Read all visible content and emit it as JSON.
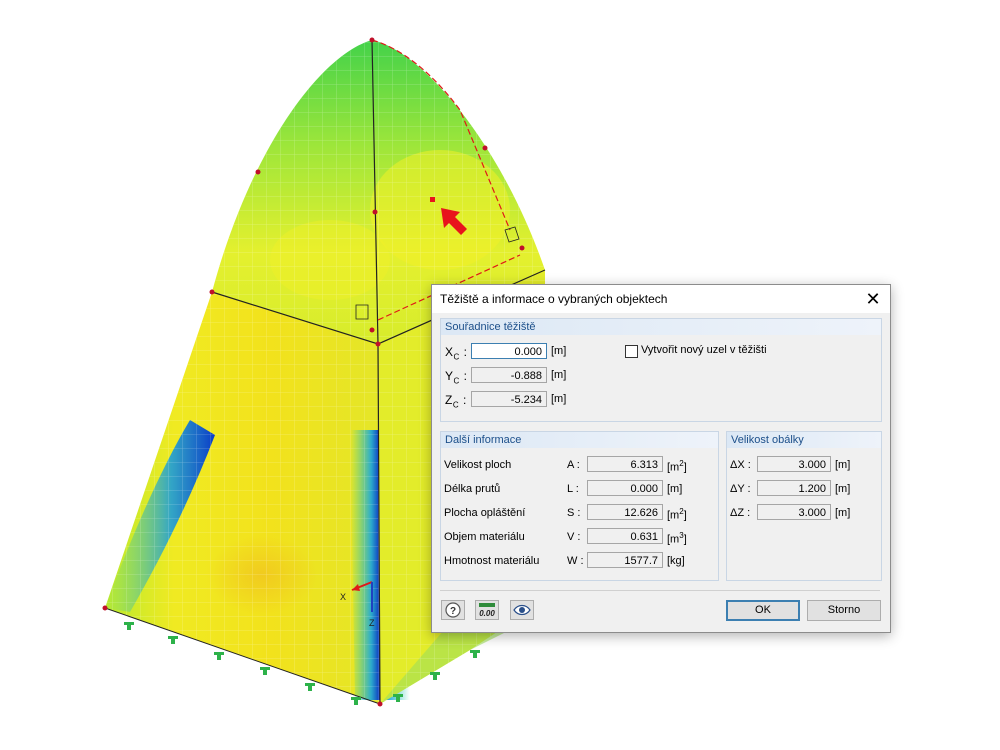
{
  "dialog": {
    "title": "Těžiště a informace o vybraných objektech",
    "close_glyph": "✕",
    "centroid": {
      "heading": "Souřadnice těžiště",
      "rows": [
        {
          "axis": "X",
          "sub": "C",
          "value": "0.000",
          "unit": "[m]"
        },
        {
          "axis": "Y",
          "sub": "C",
          "value": "-0.888",
          "unit": "[m]"
        },
        {
          "axis": "Z",
          "sub": "C",
          "value": "-5.234",
          "unit": "[m]"
        }
      ],
      "create_node_label": "Vytvořit nový uzel v těžišti"
    },
    "info": {
      "heading": "Další informace",
      "rows": [
        {
          "label": "Velikost ploch",
          "symbol": "A :",
          "value": "6.313",
          "unit": "[m",
          "sup": "2",
          "close": "]"
        },
        {
          "label": "Délka prutů",
          "symbol": "L :",
          "value": "0.000",
          "unit": "[m]",
          "sup": "",
          "close": ""
        },
        {
          "label": "Plocha opláštění",
          "symbol": "S :",
          "value": "12.626",
          "unit": "[m",
          "sup": "2",
          "close": "]"
        },
        {
          "label": "Objem materiálu",
          "symbol": "V :",
          "value": "0.631",
          "unit": "[m",
          "sup": "3",
          "close": "]"
        },
        {
          "label": "Hmotnost materiálu",
          "symbol": "W :",
          "value": "1577.7",
          "unit": "[kg]",
          "sup": "",
          "close": ""
        }
      ]
    },
    "envelope": {
      "heading": "Velikost obálky",
      "rows": [
        {
          "symbol": "ΔX :",
          "value": "3.000",
          "unit": "[m]"
        },
        {
          "symbol": "ΔY :",
          "value": "1.200",
          "unit": "[m]"
        },
        {
          "symbol": "ΔZ :",
          "value": "3.000",
          "unit": "[m]"
        }
      ]
    },
    "ok_label": "OK",
    "cancel_label": "Storno",
    "decimals_icon_text": "0.00",
    "help_icon_text": "?"
  },
  "viewport": {
    "axis_x": "X",
    "axis_z": "Z"
  },
  "colors": {
    "accent": "#3c7fb1",
    "group_heading": "#1c4f8a",
    "arrow_red": "#e8141c",
    "support_green": "#2db24a"
  }
}
